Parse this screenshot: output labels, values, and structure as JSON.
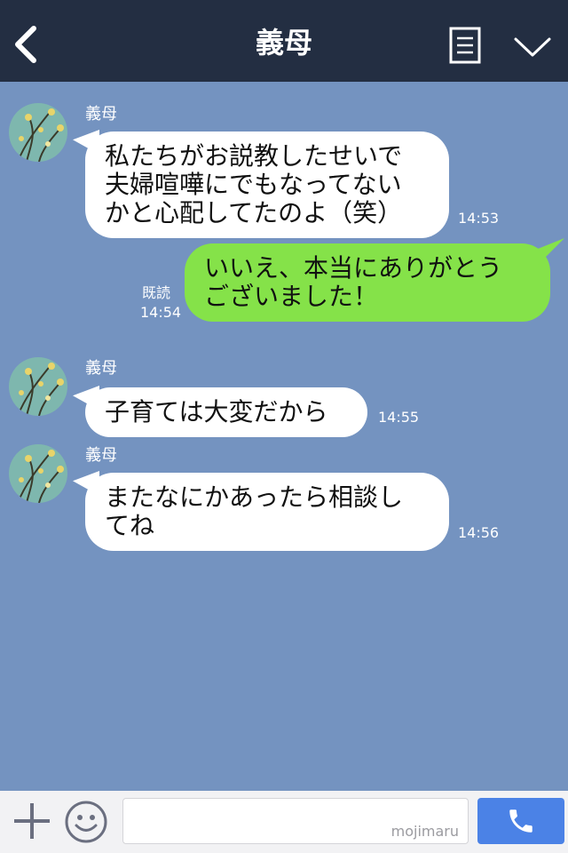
{
  "header": {
    "title": "義母"
  },
  "messages": [
    {
      "side": "in",
      "name": "義母",
      "text": "私たちがお説教したせいで\n夫婦喧嘩にでもなってない\nかと心配してたのよ（笑）",
      "time": "14:53"
    },
    {
      "side": "out",
      "text": "いいえ、本当にありがとう\nございました！",
      "read": "既読",
      "time": "14:54"
    },
    {
      "side": "in",
      "name": "義母",
      "text": "子育ては大変だから",
      "time": "14:55"
    },
    {
      "side": "in",
      "name": "義母",
      "text": "またなにかあったら相談し\nてね",
      "time": "14:56"
    }
  ],
  "footer": {
    "input_value": "",
    "watermark": "mojimaru"
  },
  "icons": [
    "back-arrow-icon",
    "menu-list-icon",
    "chevron-down-icon",
    "plus-icon",
    "smiley-icon",
    "phone-icon"
  ],
  "colors": {
    "header": "#232e42",
    "background": "#7493c0",
    "outgoing_bubble": "#85e249",
    "incoming_bubble": "#ffffff",
    "call_button": "#4b82e6"
  }
}
